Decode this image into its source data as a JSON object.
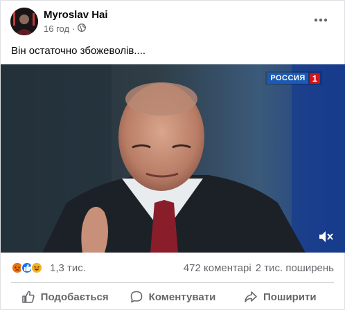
{
  "post": {
    "author": "Myroslav Hai",
    "time": "16 год",
    "privacy_icon": "globe-icon",
    "text": "Він остаточно збожеволів....",
    "video": {
      "channel_logo_text": "РОССИЯ",
      "channel_logo_num": "1"
    }
  },
  "reactions": {
    "icons": [
      "angry-icon",
      "like-icon",
      "haha-icon"
    ],
    "count": "1,3 тис.",
    "comments": "472 коментарі",
    "shares": "2 тис. поширень"
  },
  "actions": {
    "like_label": "Подобається",
    "comment_label": "Коментувати",
    "share_label": "Поширити"
  },
  "colors": {
    "secondary_text": "#65676b",
    "like_blue": "#1877f2",
    "angry_orange": "#e9710f",
    "haha_yellow": "#f7b125"
  }
}
